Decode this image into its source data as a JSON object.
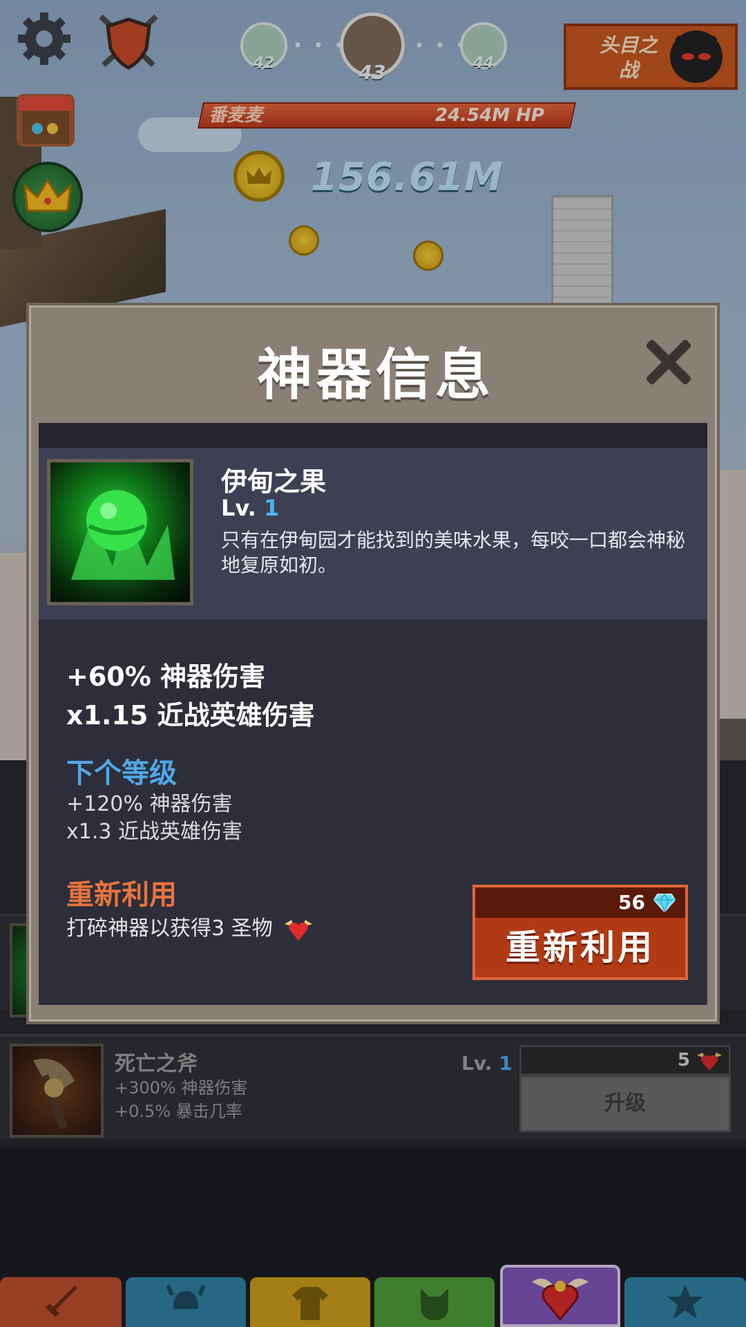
{
  "hud": {
    "stages": {
      "prev": "42",
      "current": "43",
      "next": "44"
    },
    "boss_button_label": "头目之战",
    "enemy_name": "番麦麦",
    "enemy_hp": "24.54M HP",
    "gold_amount": "156.61M"
  },
  "artifact_list": {
    "row": {
      "name": "死亡之斧",
      "stat1": "+300% 神器伤害",
      "stat2": "+0.5% 暴击几率",
      "level_prefix": "Lv.",
      "level": "1",
      "cost": "5",
      "upgrade_label": "升级"
    }
  },
  "modal": {
    "title": "神器信息",
    "item": {
      "name": "伊甸之果",
      "level_prefix": "Lv.",
      "level": "1",
      "description": "只有在伊甸园才能找到的美味水果，每咬一口都会神秘地复原如初。"
    },
    "current_stats": [
      "+60% 神器伤害",
      "x1.15 近战英雄伤害"
    ],
    "next_level": {
      "title": "下个等级",
      "stats": [
        "+120% 神器伤害",
        "x1.3 近战英雄伤害"
      ]
    },
    "recycle": {
      "title": "重新利用",
      "description": "打碎神器以获得3 圣物",
      "cost": "56",
      "button_label": "重新利用"
    }
  },
  "tabs": [
    "sword",
    "heroes",
    "equipment",
    "pets",
    "artifacts",
    "shop"
  ],
  "colors": {
    "accent_blue": "#4fa8e8",
    "recycle_orange": "#e8743e",
    "recycle_button": "#b03a14",
    "modal_frame": "#8a7f74",
    "panel_dark": "#2d2e3a"
  }
}
